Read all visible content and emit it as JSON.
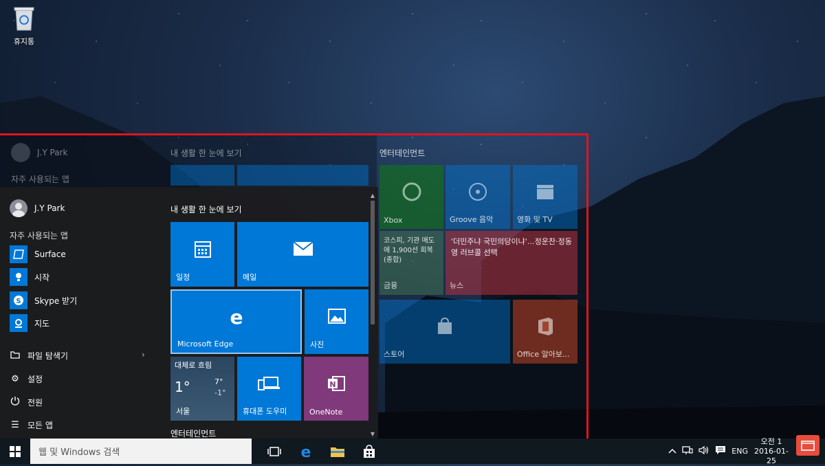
{
  "desktop": {
    "recycle_bin_label": "휴지통"
  },
  "ghost_menu": {
    "user_name": "J.Y Park",
    "frequent_header": "자주 사용되는 앱",
    "life_header": "내 생활 한 눈에 보기",
    "entertainment_header": "엔터테인먼트",
    "tiles": {
      "xbox": "Xbox",
      "groove": "Groove 음악",
      "movies": "영화 및 TV",
      "money": "금융",
      "money_headline": "코스피, 기관 매도에 1,900선 회복(종합)",
      "news": "뉴스",
      "news_headline": "'더민주냐 국민의당이냐'…정운찬·정동영 러브콜 선택",
      "store": "스토어",
      "office": "Office 알아보..."
    }
  },
  "start_menu": {
    "user_name": "J.Y Park",
    "frequent_header": "자주 사용되는 앱",
    "apps": [
      {
        "label": "Surface"
      },
      {
        "label": "시작"
      },
      {
        "label": "Skype 받기"
      },
      {
        "label": "지도"
      }
    ],
    "system": {
      "explorer": "파일 탐색기",
      "settings": "설정",
      "power": "전원",
      "all_apps": "모든 앱"
    },
    "life_header": "내 생활 한 눈에 보기",
    "entertainment_header": "엔터테인먼트",
    "tiles": {
      "calendar": "일정",
      "mail": "메일",
      "edge": "Microsoft Edge",
      "photos": "사진",
      "weather_title": "대체로 흐림",
      "weather_temp": "1°",
      "weather_high": "7°",
      "weather_low": "-1°",
      "weather_city": "서울",
      "phone": "휴대폰 도우미",
      "onenote": "OneNote"
    }
  },
  "taskbar": {
    "search_placeholder": "웹 및 Windows 검색",
    "lang": "ENG",
    "time": "오전 1",
    "date": "2016-01-25"
  },
  "colors": {
    "accent": "#0078d7",
    "onenote": "#80397b",
    "frame": "#e0141e"
  }
}
